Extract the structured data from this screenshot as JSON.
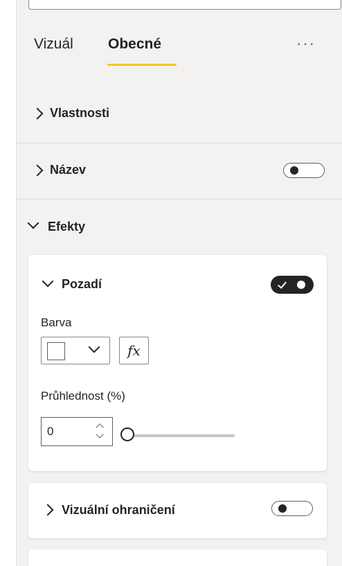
{
  "tabs": [
    {
      "label": "Vizuál",
      "active": false
    },
    {
      "label": "Obecné",
      "active": true
    }
  ],
  "more_options_icon": "ellipsis-icon",
  "more_options_text": "···",
  "accent_color": "#f2c811",
  "sections": {
    "properties": {
      "label": "Vlastnosti",
      "expanded": false
    },
    "title": {
      "label": "Název",
      "expanded": false,
      "toggle": "off"
    },
    "effects": {
      "label": "Efekty",
      "expanded": true
    }
  },
  "background_card": {
    "label": "Pozadí",
    "expanded": true,
    "toggle": "on",
    "color_label": "Barva",
    "color_value": "#ffffff",
    "fx_label": "fx",
    "transparency_label": "Průhlednost (%)",
    "transparency_value": "0",
    "slider_fraction": 0
  },
  "visual_border_card": {
    "label": "Vizuální ohraničení",
    "expanded": false,
    "toggle": "off"
  }
}
